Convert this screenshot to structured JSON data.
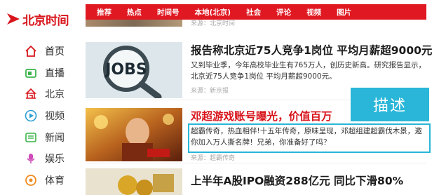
{
  "brand": {
    "logo_text": "北京时间",
    "color": "#d8161d"
  },
  "sidebar": {
    "items": [
      {
        "label": "首页",
        "icon": "home-icon",
        "active": true
      },
      {
        "label": "直播",
        "icon": "live-tv-icon"
      },
      {
        "label": "北京",
        "icon": "beijing-temple-icon"
      },
      {
        "label": "视频",
        "icon": "video-play-icon"
      },
      {
        "label": "新闻",
        "icon": "news-icon"
      },
      {
        "label": "娱乐",
        "icon": "microphone-icon"
      },
      {
        "label": "体育",
        "icon": "ball-icon"
      }
    ]
  },
  "topbar": {
    "color": "#e01822",
    "items": [
      "推荐",
      "热点",
      "时间号",
      "本地(北京)",
      "社会",
      "评论",
      "视频",
      "图片"
    ]
  },
  "feed": {
    "top_source": "来源：北京时间",
    "articles": [
      {
        "title": "报告称北京近75人竞争1岗位 平均月薪超9000元",
        "desc": "又到毕业季，今年高校毕业生有765万人，创历史新高。研究报告显示，北京近75人竞争1岗位 平均月薪超9000元。",
        "source": "来源：新京报",
        "thumb_icon": "jobs-magnifier-image"
      },
      {
        "title": "邓超游戏账号曝光，价值百万",
        "desc": "超霸传奇，热血相伴!十五年传奇，原味呈现，邓超组建超霸伐木景，邀你加入万人撕名牌！兄弟，你准备好了吗？",
        "source": "来源：超霸传奇",
        "thumb_icon": "game-promo-image"
      },
      {
        "title": "上半年A股IPO融资288亿元 同比下滑80%"
      }
    ]
  },
  "annotation": {
    "label": "描述",
    "color": "#29b6d8"
  }
}
